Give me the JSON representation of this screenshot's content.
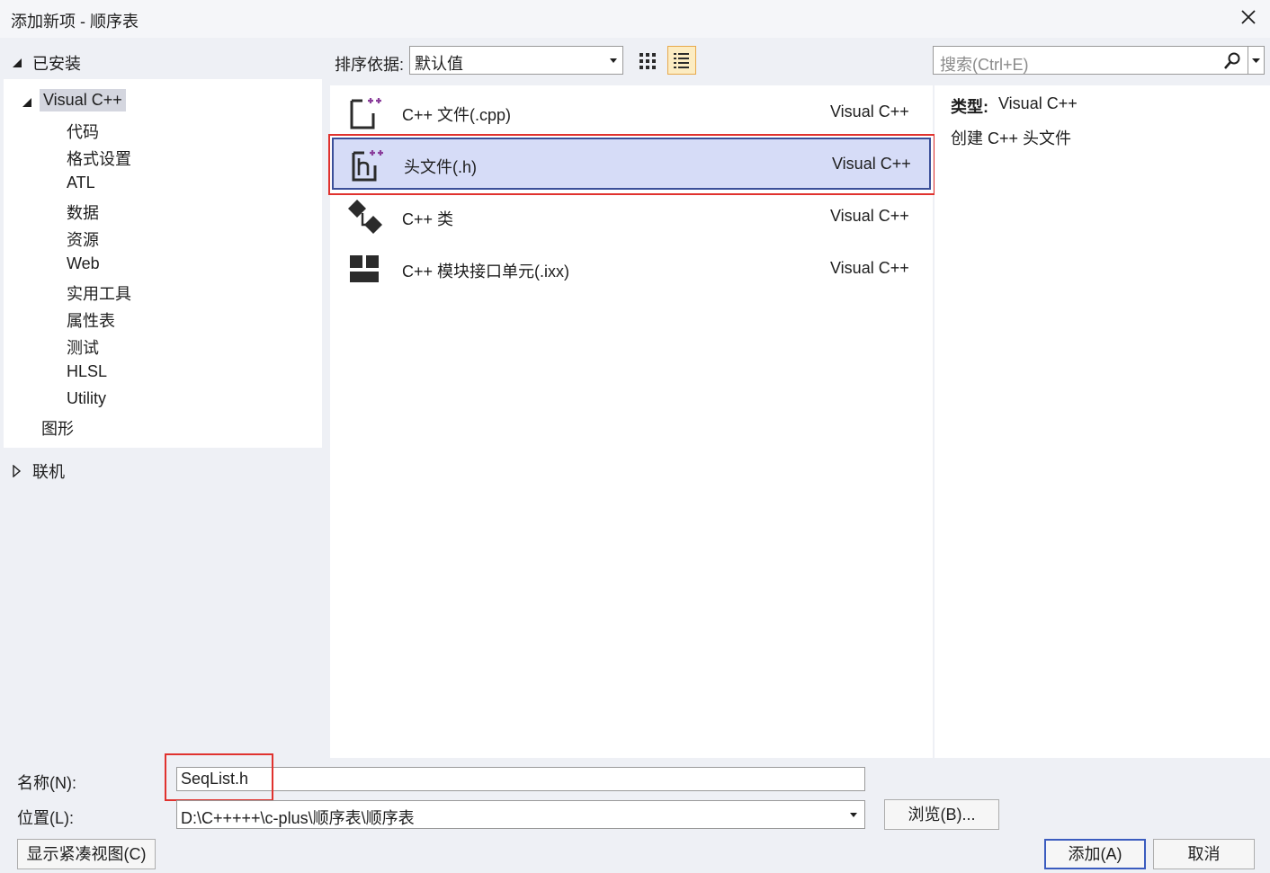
{
  "window": {
    "title": "添加新项 - 顺序表",
    "close_icon": "close-icon"
  },
  "installed": {
    "header": "已安装",
    "root": "Visual C++",
    "children": [
      "代码",
      "格式设置",
      "ATL",
      "数据",
      "资源",
      "Web",
      "实用工具",
      "属性表",
      "测试",
      "HLSL",
      "Utility"
    ],
    "sibling": "图形"
  },
  "online": {
    "header": "联机"
  },
  "toolbar": {
    "sort_label": "排序依据:",
    "sort_value": "默认值",
    "search_placeholder": "搜索(Ctrl+E)"
  },
  "templates": [
    {
      "name": "C++ 文件(.cpp)",
      "lang": "Visual C++",
      "icon": "cpp-file-icon"
    },
    {
      "name": "头文件(.h)",
      "lang": "Visual C++",
      "icon": "header-file-icon",
      "selected": true
    },
    {
      "name": "C++ 类",
      "lang": "Visual C++",
      "icon": "class-icon"
    },
    {
      "name": "C++ 模块接口单元(.ixx)",
      "lang": "Visual C++",
      "icon": "module-icon"
    }
  ],
  "details": {
    "type_label": "类型:",
    "type_value": "Visual C++",
    "description": "创建 C++ 头文件"
  },
  "form": {
    "name_label": "名称(N):",
    "name_value": "SeqList.h",
    "location_label": "位置(L):",
    "location_value": "D:\\C+++++\\c-plus\\顺序表\\顺序表",
    "browse": "浏览(B)...",
    "compact": "显示紧凑视图(C)",
    "add": "添加(A)",
    "cancel": "取消"
  },
  "colors": {
    "accent": "#3b4f99",
    "selection_bg": "#d6dcf7",
    "highlight_red": "#e0322e",
    "icon_plus": "#8a3e9b"
  }
}
